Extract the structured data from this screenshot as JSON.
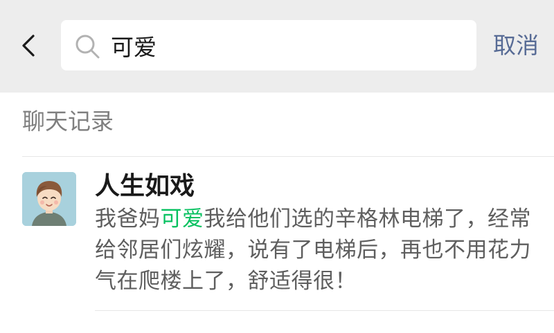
{
  "search": {
    "query": "可爱",
    "cancel_label": "取消"
  },
  "icons": {
    "back": "chevron-left-icon",
    "search": "search-icon"
  },
  "colors": {
    "topbar_bg": "#ededed",
    "highlight": "#07c160",
    "link": "#576b95",
    "avatar_bg": "#a8d1dd"
  },
  "results": {
    "section_title": "聊天记录",
    "items": [
      {
        "name": "人生如戏",
        "message_before": "我爸妈",
        "message_match": "可爱",
        "message_after": "我给他们选的辛格林电梯了，经常给邻居们炫耀，说有了电梯后，再也不用花力气在爬楼上了，舒适得很！"
      }
    ]
  }
}
